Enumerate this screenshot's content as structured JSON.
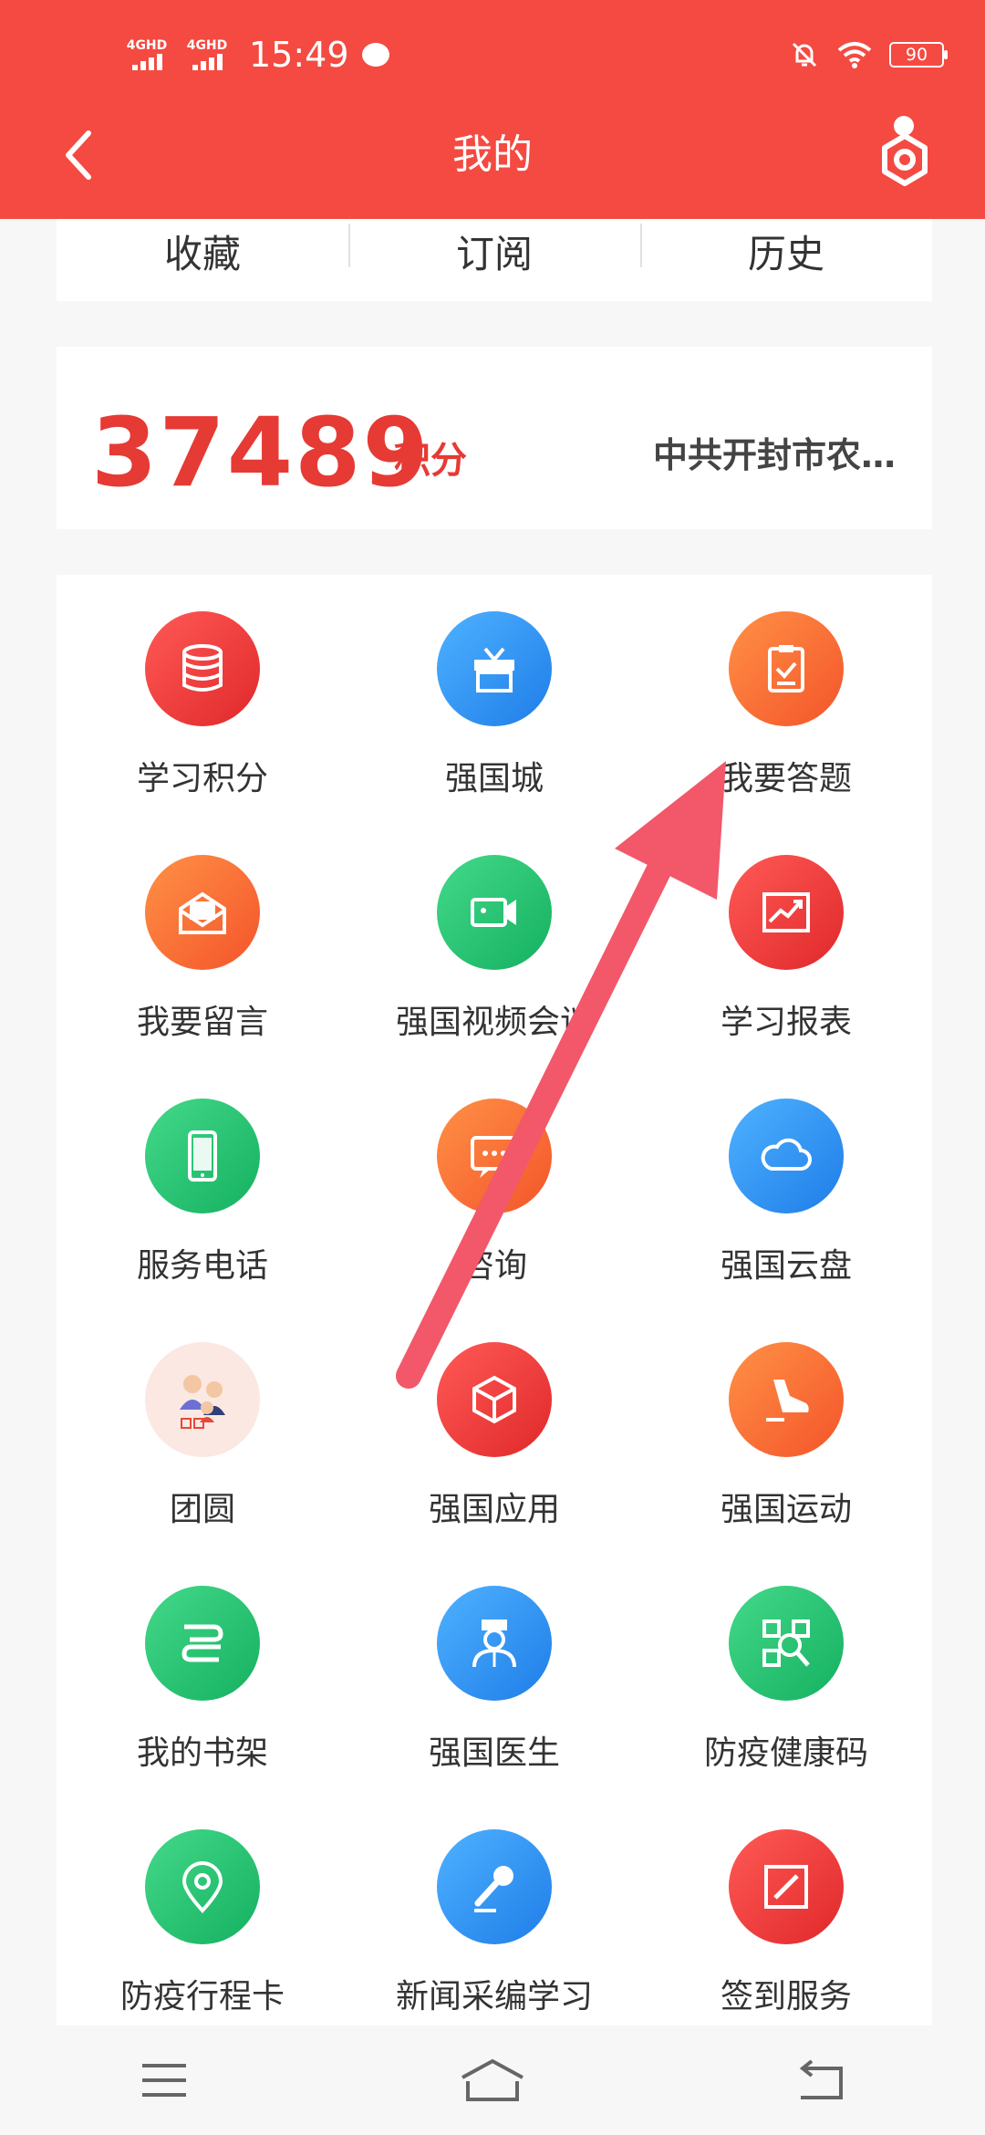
{
  "status_bar": {
    "network1": "4GHD",
    "network2": "4GHD",
    "time": "15:49",
    "battery": "90"
  },
  "header": {
    "title": "我的"
  },
  "tabs": [
    {
      "label": "收藏"
    },
    {
      "label": "订阅"
    },
    {
      "label": "历史"
    }
  ],
  "points": {
    "value": "37489",
    "unit": "积分",
    "organization": "中共开封市农…"
  },
  "grid": [
    {
      "label": "学习积分",
      "icon": "database-icon",
      "color": "#e8302e"
    },
    {
      "label": "强国城",
      "icon": "gift-box-icon",
      "color": "#2a8cf0"
    },
    {
      "label": "我要答题",
      "icon": "clipboard-check-icon",
      "color": "#f96a35"
    },
    {
      "label": "我要留言",
      "icon": "envelope-letter-icon",
      "color": "#f96a35"
    },
    {
      "label": "强国视频会议",
      "icon": "video-camera-icon",
      "color": "#1fbd6a"
    },
    {
      "label": "学习报表",
      "icon": "trend-chart-icon",
      "color": "#e8302e"
    },
    {
      "label": "服务电话",
      "icon": "mobile-phone-icon",
      "color": "#1fbd6a"
    },
    {
      "label": "咨询",
      "icon": "chat-bubble-icon",
      "color": "#f96a35"
    },
    {
      "label": "强国云盘",
      "icon": "cloud-icon",
      "color": "#2a8cf0"
    },
    {
      "label": "团圆",
      "icon": "family-illustration-icon",
      "color": "#fbe8e2"
    },
    {
      "label": "强国应用",
      "icon": "cube-icon",
      "color": "#e8302e"
    },
    {
      "label": "强国运动",
      "icon": "sneaker-icon",
      "color": "#f96a35"
    },
    {
      "label": "我的书架",
      "icon": "books-icon",
      "color": "#1fbd6a"
    },
    {
      "label": "强国医生",
      "icon": "doctor-icon",
      "color": "#2a8cf0"
    },
    {
      "label": "防疫健康码",
      "icon": "qr-scan-icon",
      "color": "#1fbd6a"
    },
    {
      "label": "防疫行程卡",
      "icon": "location-pin-icon",
      "color": "#1fbd6a"
    },
    {
      "label": "新闻采编学习",
      "icon": "microphone-icon",
      "color": "#2a8cf0"
    },
    {
      "label": "签到服务",
      "icon": "pen-sign-icon",
      "color": "#e8302e"
    }
  ]
}
